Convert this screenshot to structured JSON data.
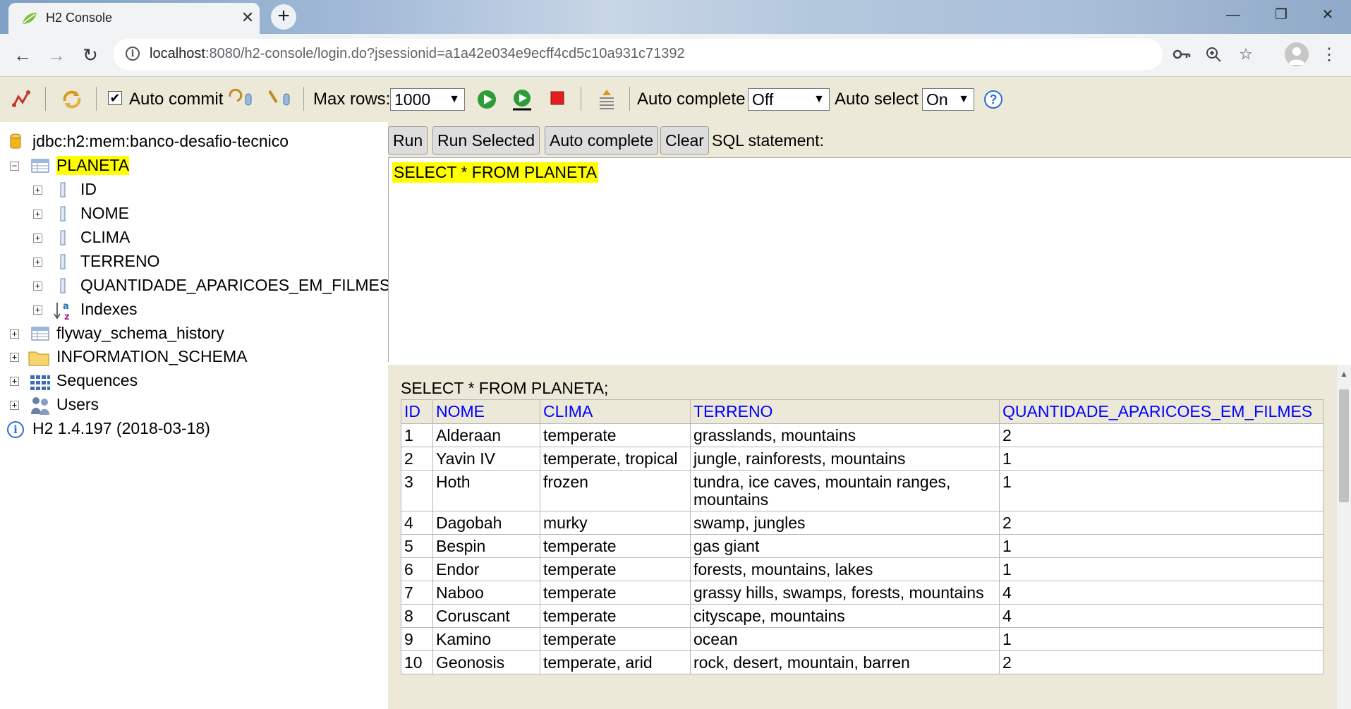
{
  "browser": {
    "tab_title": "H2 Console",
    "tab_close": "✕",
    "new_tab": "+",
    "url_host": "localhost",
    "url_path": ":8080/h2-console/login.do?jsessionid=a1a42e034e9ecff4cd5c10a931c71392",
    "window_controls": [
      "—",
      "❐",
      "✕"
    ]
  },
  "h2_toolbar": {
    "auto_commit_label": "Auto commit",
    "auto_commit_checked": "✔",
    "max_rows_label": "Max rows:",
    "max_rows_value": "1000",
    "auto_complete_label": "Auto complete",
    "auto_complete_value": "Off",
    "auto_select_label": "Auto select",
    "auto_select_value": "On",
    "help": "?"
  },
  "tree": {
    "connection": "jdbc:h2:mem:banco-desafio-tecnico",
    "table": "PLANETA",
    "columns": [
      "ID",
      "NOME",
      "CLIMA",
      "TERRENO",
      "QUANTIDADE_APARICOES_EM_FILMES"
    ],
    "indexes": "Indexes",
    "flyway": "flyway_schema_history",
    "information_schema": "INFORMATION_SCHEMA",
    "sequences": "Sequences",
    "users": "Users",
    "version": "H2 1.4.197 (2018-03-18)"
  },
  "sql": {
    "run": "Run",
    "run_selected": "Run Selected",
    "auto_complete": "Auto complete",
    "clear": "Clear",
    "statement_label": "SQL statement:",
    "editor_text": "SELECT * FROM PLANETA"
  },
  "result": {
    "query": "SELECT * FROM PLANETA;",
    "headers": [
      "ID",
      "NOME",
      "CLIMA",
      "TERRENO",
      "QUANTIDADE_APARICOES_EM_FILMES"
    ],
    "rows": [
      [
        "1",
        "Alderaan",
        "temperate",
        "grasslands, mountains",
        "2"
      ],
      [
        "2",
        "Yavin IV",
        "temperate, tropical",
        "jungle, rainforests, mountains",
        "1"
      ],
      [
        "3",
        "Hoth",
        "frozen",
        "tundra, ice caves, mountain ranges, mountains",
        "1"
      ],
      [
        "4",
        "Dagobah",
        "murky",
        "swamp, jungles",
        "2"
      ],
      [
        "5",
        "Bespin",
        "temperate",
        "gas giant",
        "1"
      ],
      [
        "6",
        "Endor",
        "temperate",
        "forests, mountains, lakes",
        "1"
      ],
      [
        "7",
        "Naboo",
        "temperate",
        "grassy hills, swamps, forests, mountains",
        "4"
      ],
      [
        "8",
        "Coruscant",
        "temperate",
        "cityscape, mountains",
        "4"
      ],
      [
        "9",
        "Kamino",
        "temperate",
        "ocean",
        "1"
      ],
      [
        "10",
        "Geonosis",
        "temperate, arid",
        "rock, desert, mountain, barren",
        "2"
      ]
    ]
  },
  "colors": {
    "highlight": "#ffff00",
    "header_link": "#0000ff",
    "panel_bg": "#ece9d8"
  }
}
